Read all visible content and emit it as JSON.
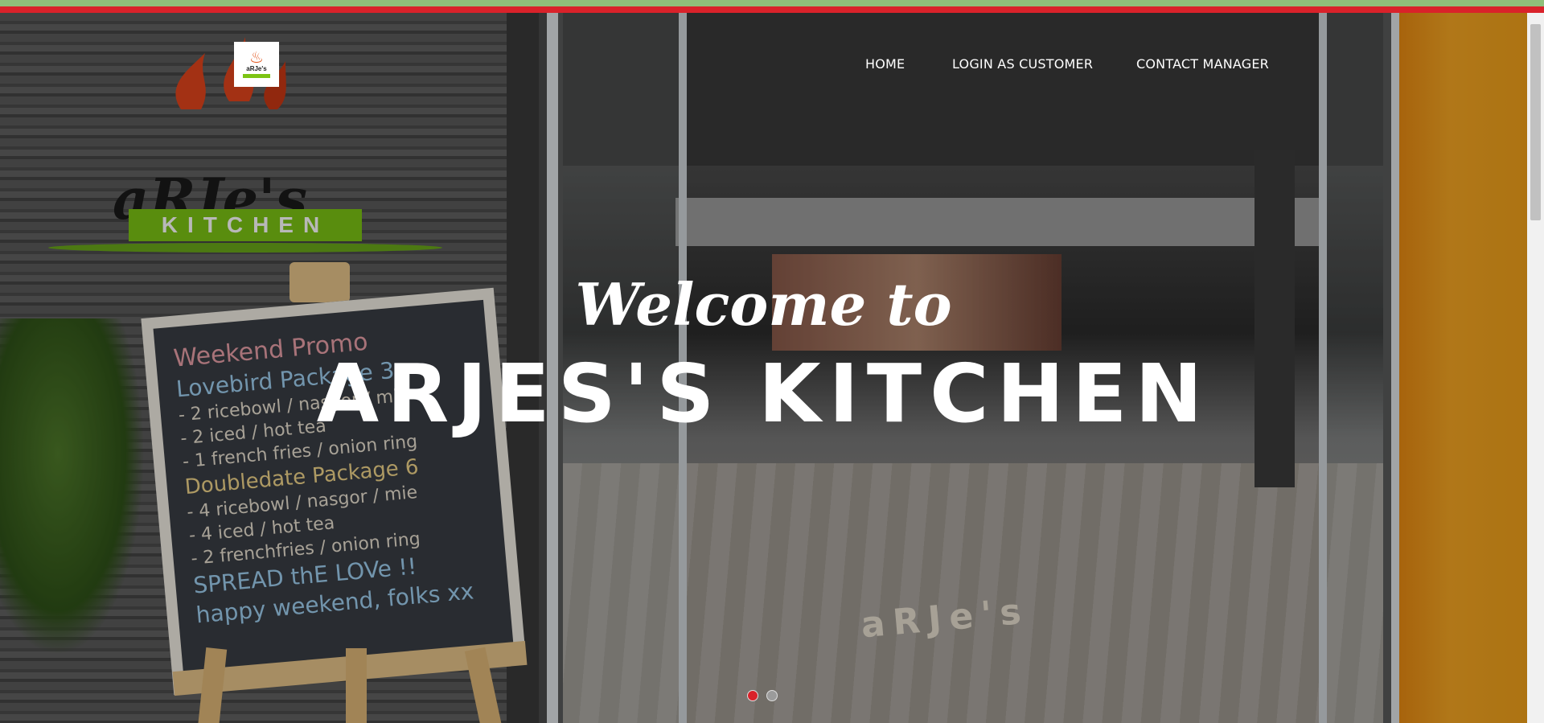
{
  "brand": {
    "logo_text": "aRJe's",
    "icon": "flame-logo-icon"
  },
  "nav": {
    "items": [
      {
        "label": "HOME"
      },
      {
        "label": "LOGIN AS CUSTOMER"
      },
      {
        "label": "CONTACT MANAGER"
      }
    ]
  },
  "hero": {
    "welcome": "Welcome to",
    "title": "ARJES'S KITCHEN",
    "background": {
      "sign_name": "aRJe's",
      "sign_band": "KITCHEN",
      "board_lines": [
        "aRJe's",
        "Weekend Promo",
        "Lovebird Package 3",
        "- 2 ricebowl / nasgor / mie",
        "- 2 iced / hot tea",
        "- 1 french fries / onion ring",
        "Doubledate Package 6",
        "- 4 ricebowl / nasgor / mie",
        "- 4 iced / hot tea",
        "- 2 frenchfries / onion ring",
        "SPREAD thE LOVe !!",
        "happy weekend, folks xx"
      ]
    }
  },
  "carousel": {
    "slides": 2,
    "active_index": 0,
    "active_color": "#d9222a",
    "inactive_color": "#9b9b9b"
  },
  "colors": {
    "top_stripe_green": "#8fbf7a",
    "top_stripe_red": "#d9222a",
    "brand_green": "#7cc414"
  }
}
